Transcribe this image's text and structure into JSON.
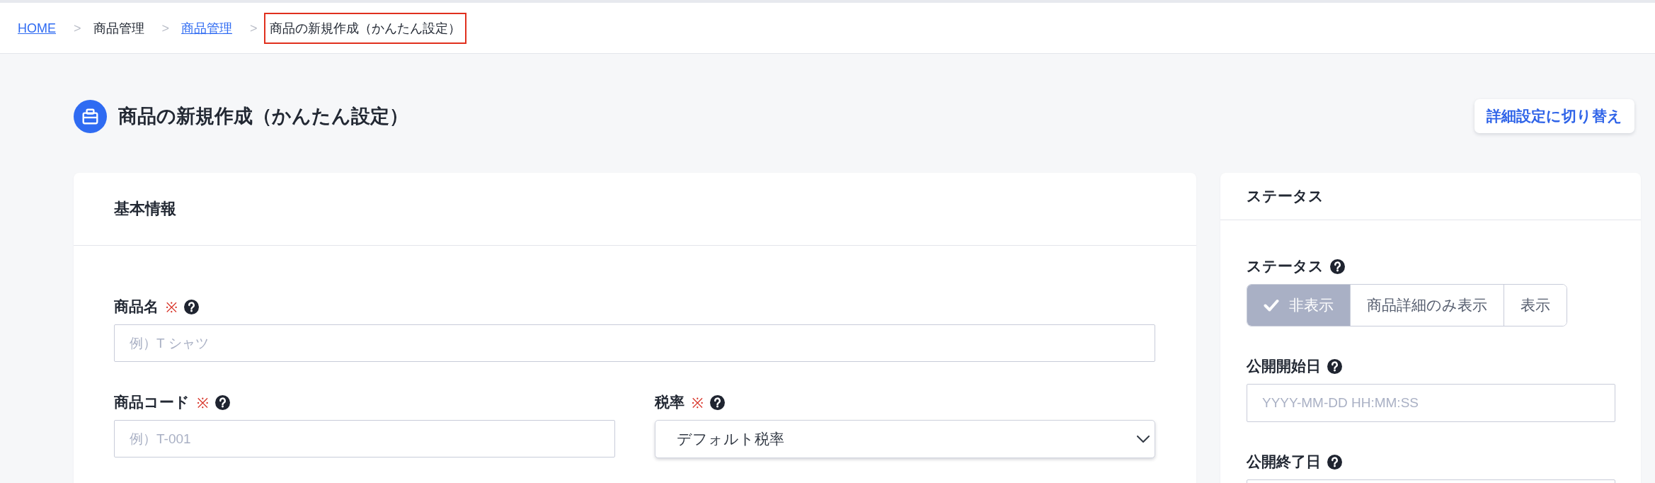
{
  "breadcrumb": [
    {
      "kind": "link",
      "label": "HOME",
      "highlighted": false
    },
    {
      "kind": "text",
      "separator": ">",
      "label": "商品管理",
      "highlighted": false
    },
    {
      "kind": "link",
      "separator": ">",
      "label": "商品管理",
      "highlighted": false
    },
    {
      "kind": "text",
      "separator": ">",
      "label": "商品の新規作成（かんたん設定）",
      "highlighted": true
    }
  ],
  "page_header": {
    "title": "商品の新規作成（かんたん設定）",
    "switch_button": "詳細設定に切り替え"
  },
  "basic_info_card": {
    "title": "基本情報",
    "rows": [
      {
        "fields": [
          {
            "kind": "text",
            "label": "商品名",
            "required_mark": "※",
            "help": true,
            "placeholder": "例）T シャツ"
          }
        ]
      },
      {
        "fields": [
          {
            "kind": "text",
            "label": "商品コード",
            "required_mark": "※",
            "help": true,
            "placeholder": "例）T-001"
          },
          {
            "kind": "select",
            "label": "税率",
            "required_mark": "※",
            "help": true,
            "value": "デフォルト税率"
          }
        ]
      }
    ]
  },
  "status_card": {
    "title": "ステータス",
    "rows": [
      {
        "fields": [
          {
            "kind": "segmented",
            "label": "ステータス",
            "help": true,
            "options": [
              {
                "label": "非表示",
                "selected": true
              },
              {
                "label": "商品詳細のみ表示",
                "selected": false
              },
              {
                "label": "表示",
                "selected": false
              }
            ]
          }
        ]
      },
      {
        "fields": [
          {
            "kind": "text",
            "label": "公開開始日",
            "help": true,
            "placeholder": "YYYY-MM-DD HH:MM:SS"
          }
        ]
      },
      {
        "fields": [
          {
            "kind": "text",
            "label": "公開終了日",
            "help": true
          }
        ]
      }
    ]
  }
}
